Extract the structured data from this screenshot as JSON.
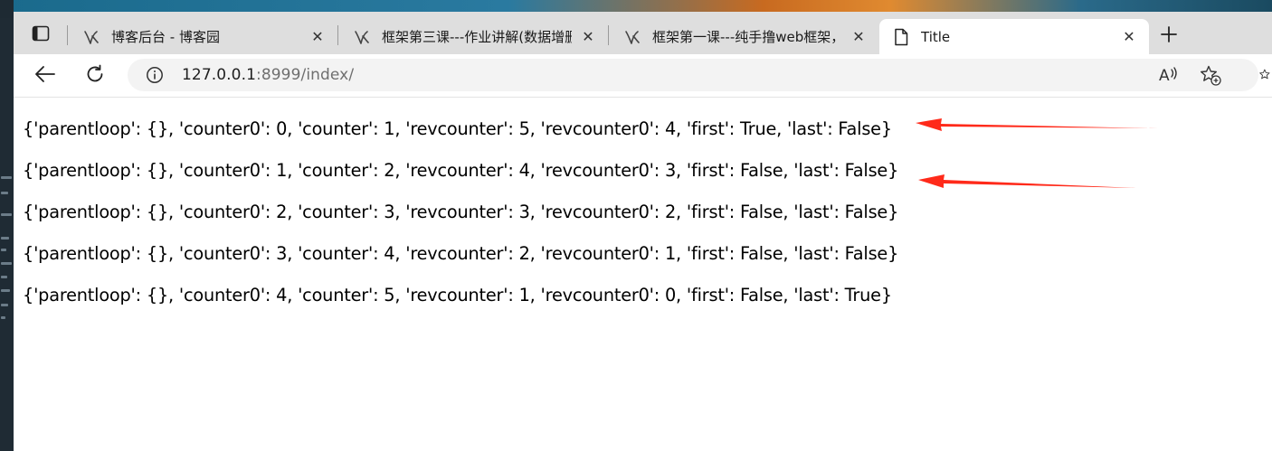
{
  "browser": {
    "tabs": [
      {
        "title": "博客后台 - 博客园",
        "favicon": "cnblogs-icon",
        "active": false
      },
      {
        "title": "框架第三课---作业讲解(数据增删",
        "favicon": "cnblogs-icon",
        "active": false
      },
      {
        "title": "框架第一课---纯手撸web框架，基",
        "favicon": "cnblogs-icon",
        "active": false
      },
      {
        "title": "Title",
        "favicon": "page-icon",
        "active": true
      }
    ],
    "url": {
      "host": "127.0.0.1",
      "rest": ":8999/index/"
    }
  },
  "content": {
    "lines": [
      "{'parentloop': {}, 'counter0': 0, 'counter': 1, 'revcounter': 5, 'revcounter0': 4, 'first': True, 'last': False}",
      "{'parentloop': {}, 'counter0': 1, 'counter': 2, 'revcounter': 4, 'revcounter0': 3, 'first': False, 'last': False}",
      "{'parentloop': {}, 'counter0': 2, 'counter': 3, 'revcounter': 3, 'revcounter0': 2, 'first': False, 'last': False}",
      "{'parentloop': {}, 'counter0': 3, 'counter': 4, 'revcounter': 2, 'revcounter0': 1, 'first': False, 'last': False}",
      "{'parentloop': {}, 'counter0': 4, 'counter': 5, 'revcounter': 1, 'revcounter0': 0, 'first': False, 'last': True}"
    ]
  },
  "annotations": {
    "arrow_color": "#ff2a1a"
  }
}
